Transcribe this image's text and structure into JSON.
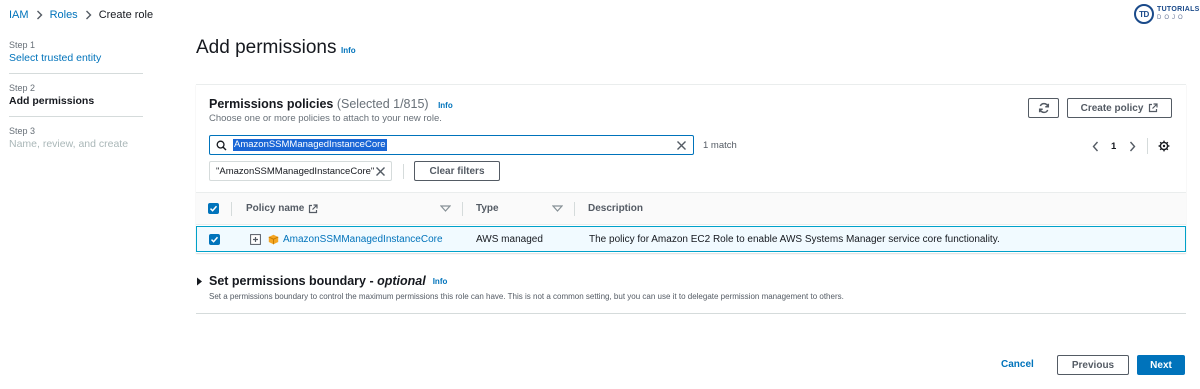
{
  "breadcrumb": {
    "items": [
      "IAM",
      "Roles"
    ],
    "current": "Create role"
  },
  "logo": {
    "badge": "TD",
    "top": "TUTORIALS",
    "bottom": "DOJO"
  },
  "steps": [
    {
      "num": "Step 1",
      "title": "Select trusted entity",
      "state": "link"
    },
    {
      "num": "Step 2",
      "title": "Add permissions",
      "state": "active"
    },
    {
      "num": "Step 3",
      "title": "Name, review, and create",
      "state": "disabled"
    }
  ],
  "page": {
    "title": "Add permissions",
    "info": "Info"
  },
  "policies": {
    "title": "Permissions policies",
    "count": "(Selected 1/815)",
    "info": "Info",
    "description": "Choose one or more policies to attach to your new role.",
    "create_label": "Create policy",
    "search_value": "AmazonSSMManagedInstanceCore",
    "match_count": "1 match",
    "filter_token": "\"AmazonSSMManagedInstanceCore\"",
    "clear_filters": "Clear filters",
    "page_number": "1",
    "columns": {
      "name": "Policy name",
      "type": "Type",
      "description": "Description"
    },
    "rows": [
      {
        "name": "AmazonSSMManagedInstanceCore",
        "type": "AWS managed",
        "description": "The policy for Amazon EC2 Role to enable AWS Systems Manager service core functionality.",
        "selected": true
      }
    ]
  },
  "boundary": {
    "title": "Set permissions boundary - ",
    "title_em": "optional",
    "info": "Info",
    "description": "Set a permissions boundary to control the maximum permissions this role can have. This is not a common setting, but you can use it to delegate permission management to others."
  },
  "footer": {
    "cancel": "Cancel",
    "previous": "Previous",
    "next": "Next"
  },
  "colors": {
    "link": "#0073bb",
    "primary": "#0073bb",
    "selected_row_bg": "#f1faff",
    "selected_row_border": "#00a1c9",
    "search_highlight": "#1a66d6"
  }
}
